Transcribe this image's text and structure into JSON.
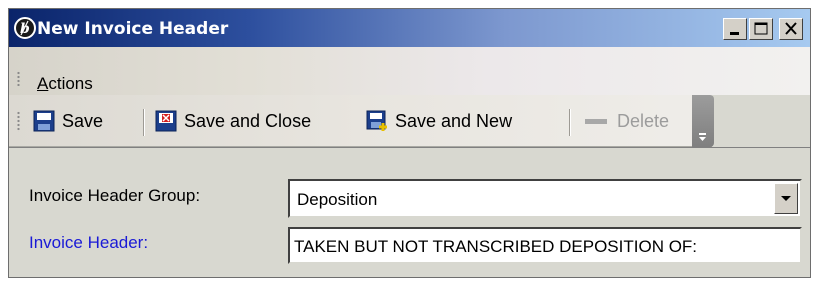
{
  "window": {
    "title": "New Invoice Header",
    "controls": {
      "minimize_icon": "minimize-icon",
      "maximize_icon": "maximize-icon",
      "close_icon": "close-icon"
    },
    "title_bar_gradient": [
      "#0a246a",
      "#a6caf0"
    ]
  },
  "menubar": {
    "items": [
      {
        "label_underlined": "A",
        "label_rest": "ctions"
      }
    ]
  },
  "toolbar": {
    "save_label": "Save",
    "save_icon": "floppy-disk-icon",
    "save_close_label": "Save and Close",
    "save_close_icon": "floppy-disk-close-icon",
    "save_new_label": "Save and New",
    "save_new_icon": "floppy-disk-new-icon",
    "delete_label": "Delete",
    "delete_icon": "delete-dash-icon",
    "delete_enabled": false
  },
  "form": {
    "group_label": "Invoice Header Group:",
    "group_value": "Deposition",
    "header_label": "Invoice Header:",
    "header_label_color": "#1a1ad6",
    "header_value": "TAKEN BUT NOT TRANSCRIBED DEPOSITION OF:"
  }
}
